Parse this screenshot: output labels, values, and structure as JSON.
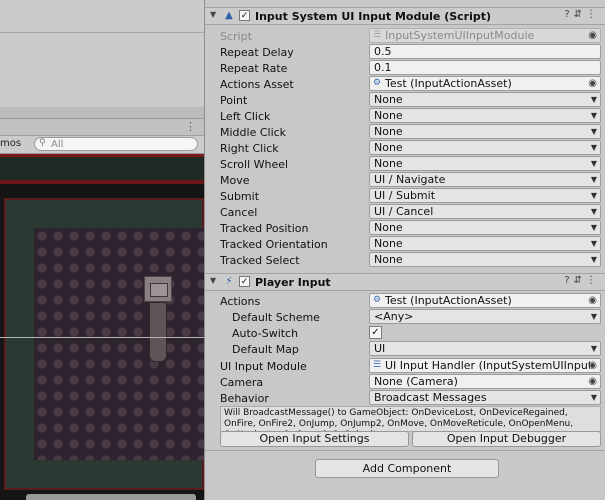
{
  "left_panel": {
    "gizmos_label": "mos",
    "search_placeholder": "All",
    "search_icon": "search-icon"
  },
  "input_module": {
    "title": "Input System UI Input Module (Script)",
    "rows": [
      {
        "label": "Script",
        "value": "InputSystemUIInputModule",
        "kind": "object-disabled"
      },
      {
        "label": "Repeat Delay",
        "value": "0.5",
        "kind": "text"
      },
      {
        "label": "Repeat Rate",
        "value": "0.1",
        "kind": "text"
      },
      {
        "label": "Actions Asset",
        "value": "Test (InputActionAsset)",
        "kind": "object"
      },
      {
        "label": "Point",
        "value": "None",
        "kind": "dropdown"
      },
      {
        "label": "Left Click",
        "value": "None",
        "kind": "dropdown"
      },
      {
        "label": "Middle Click",
        "value": "None",
        "kind": "dropdown"
      },
      {
        "label": "Right Click",
        "value": "None",
        "kind": "dropdown"
      },
      {
        "label": "Scroll Wheel",
        "value": "None",
        "kind": "dropdown"
      },
      {
        "label": "Move",
        "value": "UI / Navigate",
        "kind": "dropdown"
      },
      {
        "label": "Submit",
        "value": "UI / Submit",
        "kind": "dropdown"
      },
      {
        "label": "Cancel",
        "value": "UI / Cancel",
        "kind": "dropdown"
      },
      {
        "label": "Tracked Position",
        "value": "None",
        "kind": "dropdown"
      },
      {
        "label": "Tracked Orientation",
        "value": "None",
        "kind": "dropdown"
      },
      {
        "label": "Tracked Select",
        "value": "None",
        "kind": "dropdown"
      }
    ]
  },
  "player_input": {
    "title": "Player Input",
    "actions": {
      "label": "Actions",
      "value": "Test (InputActionAsset)"
    },
    "default_scheme": {
      "label": "Default Scheme",
      "value": "<Any>"
    },
    "auto_switch": {
      "label": "Auto-Switch",
      "checked": "✓"
    },
    "default_map": {
      "label": "Default Map",
      "value": "UI"
    },
    "ui_input_module": {
      "label": "UI Input Module",
      "value": "UI Input Handler (InputSystemUIInputModule)"
    },
    "camera": {
      "label": "Camera",
      "value": "None (Camera)"
    },
    "behavior": {
      "label": "Behavior",
      "value": "Broadcast Messages"
    },
    "help_text": "Will BroadcastMessage() to GameObject: OnDeviceLost, OnDeviceRegained, OnFire, OnFire2, OnJump, OnJump2, OnMove, OnMoveReticule, OnOpenMenu, OnNavigate, OnCancel, OnSubmit",
    "open_settings_label": "Open Input Settings",
    "open_debugger_label": "Open Input Debugger"
  },
  "add_component_label": "Add Component",
  "header_check": "✓",
  "header_icons": "?⇵⋮"
}
